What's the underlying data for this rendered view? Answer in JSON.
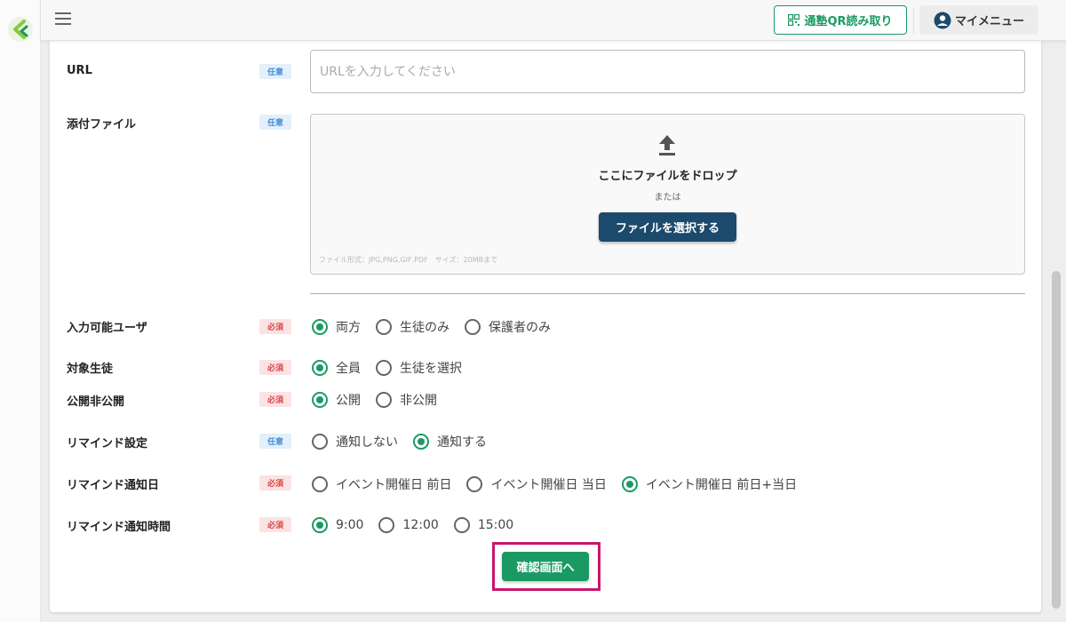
{
  "header": {
    "qr_button_label": "通塾QR読み取り",
    "my_menu_label": "マイメニュー"
  },
  "colors": {
    "accent_green": "#1a9a62",
    "navy_button": "#1c4a6c",
    "highlight_frame": "#c8166c",
    "badge_required": "#d94646",
    "badge_optional": "#4a8fd0"
  },
  "form": {
    "url": {
      "label": "URL",
      "badge": "任意",
      "placeholder": "URLを入力してください",
      "value": ""
    },
    "attachment": {
      "label": "添付ファイル",
      "badge": "任意",
      "drop_text": "ここにファイルをドロップ",
      "or_text": "または",
      "select_button": "ファイルを選択する",
      "hint": "ファイル形式：JPG,PNG,GIF,PDF　サイズ：20MBまで"
    },
    "input_users": {
      "label": "入力可能ユーザ",
      "badge": "必須",
      "options": [
        "両方",
        "生徒のみ",
        "保護者のみ"
      ],
      "selected": "両方"
    },
    "target_students": {
      "label": "対象生徒",
      "badge": "必須",
      "options": [
        "全員",
        "生徒を選択"
      ],
      "selected": "全員"
    },
    "visibility": {
      "label": "公開非公開",
      "badge": "必須",
      "options": [
        "公開",
        "非公開"
      ],
      "selected": "公開"
    },
    "reminder": {
      "label": "リマインド設定",
      "badge": "任意",
      "options": [
        "通知しない",
        "通知する"
      ],
      "selected": "通知する"
    },
    "reminder_day": {
      "label": "リマインド通知日",
      "badge": "必須",
      "options": [
        "イベント開催日 前日",
        "イベント開催日 当日",
        "イベント開催日 前日+当日"
      ],
      "selected": "イベント開催日 前日+当日"
    },
    "reminder_time": {
      "label": "リマインド通知時間",
      "badge": "必須",
      "options": [
        "9:00",
        "12:00",
        "15:00"
      ],
      "selected": "9:00"
    },
    "confirm_button": "確認画面へ"
  }
}
